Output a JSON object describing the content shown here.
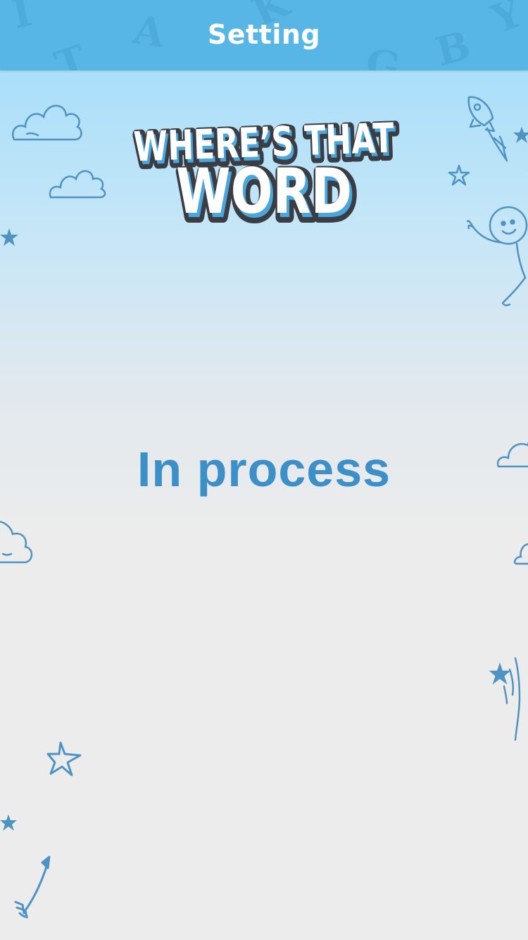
{
  "header": {
    "title": "Setting"
  },
  "logo": {
    "line1": "WHERE’S THAT",
    "line2": "WORD"
  },
  "main": {
    "status": "In process"
  },
  "colors": {
    "header_bg": "#57b6e6",
    "status_text": "#3c8fc7",
    "doodle_stroke": "#4f93c3",
    "logo_outline": "#3a3d44",
    "logo_shadow": "#4aa6dc"
  }
}
